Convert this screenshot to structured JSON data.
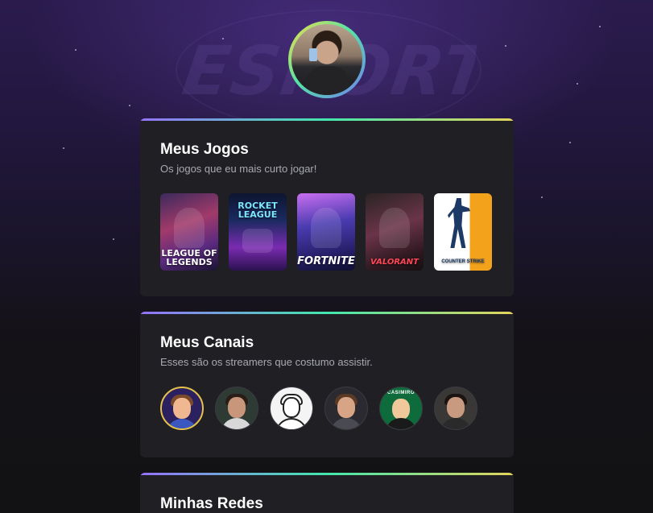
{
  "profile": {
    "avatar_icon": "profile-photo"
  },
  "games_section": {
    "title": "Meus Jogos",
    "subtitle": "Os jogos que eu mais curto jogar!",
    "games": [
      {
        "name": "League of Legends",
        "cover_text": "LEAGUE OF LEGENDS"
      },
      {
        "name": "Rocket League",
        "cover_text": "ROCKET LEAGUE"
      },
      {
        "name": "Fortnite",
        "cover_text": "FORTNITE"
      },
      {
        "name": "Valorant",
        "cover_text": "VALORANT"
      },
      {
        "name": "Counter-Strike",
        "cover_text": "COUNTER STRIKE"
      }
    ]
  },
  "channels_section": {
    "title": "Meus Canais",
    "subtitle": "Esses são os streamers que costumo assistir.",
    "badge_text": "CASIMIRO"
  },
  "networks_section": {
    "title": "Minhas Redes"
  },
  "colors": {
    "background": "#121214",
    "card": "#202024",
    "accent_gradient": [
      "#9572fc",
      "#43e7ad",
      "#e2d45c"
    ],
    "text_primary": "#ffffff",
    "text_secondary": "#a8a8b3"
  }
}
